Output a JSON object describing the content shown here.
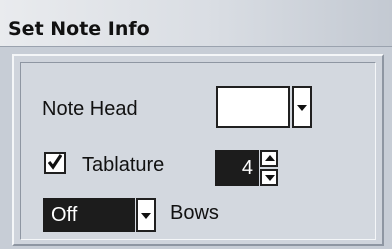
{
  "dialog": {
    "title": "Set Note Info"
  },
  "note_head": {
    "label": "Note Head",
    "swatch_color": "#ffffff"
  },
  "tablature": {
    "checkbox_checked": true,
    "label": "Tablature",
    "value": "4"
  },
  "bows": {
    "selected": "Off",
    "label": "Bows"
  }
}
